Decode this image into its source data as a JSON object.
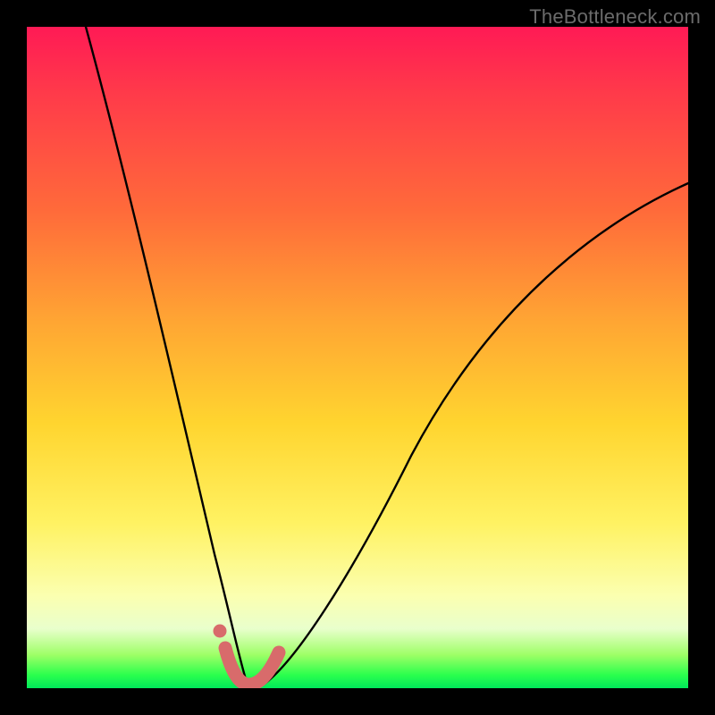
{
  "watermark": {
    "text": "TheBottleneck.com"
  },
  "chart_data": {
    "type": "line",
    "title": "",
    "xlabel": "",
    "ylabel": "",
    "xlim": [
      0,
      100
    ],
    "ylim": [
      0,
      100
    ],
    "series": [
      {
        "name": "bottleneck-curve",
        "x": [
          9,
          12,
          15,
          18,
          21,
          24,
          26,
          28,
          30,
          31,
          32,
          33,
          34,
          36,
          38,
          41,
          45,
          50,
          56,
          63,
          71,
          80,
          90,
          100
        ],
        "values": [
          100,
          82,
          66,
          52,
          39,
          28,
          19,
          12,
          6,
          3,
          1,
          0,
          0.5,
          2,
          5,
          10,
          17,
          26,
          36,
          46,
          55,
          63,
          70,
          76
        ]
      },
      {
        "name": "optimal-marker-band",
        "x": [
          30,
          31,
          32,
          33,
          34,
          35,
          36,
          37
        ],
        "values": [
          6,
          3,
          1,
          0,
          0.2,
          0.8,
          2,
          4
        ]
      },
      {
        "name": "optimal-marker-dot",
        "x": [
          29.3
        ],
        "values": [
          8.5
        ]
      }
    ],
    "colors": {
      "curve": "#000000",
      "marker": "#d86b6b"
    }
  }
}
